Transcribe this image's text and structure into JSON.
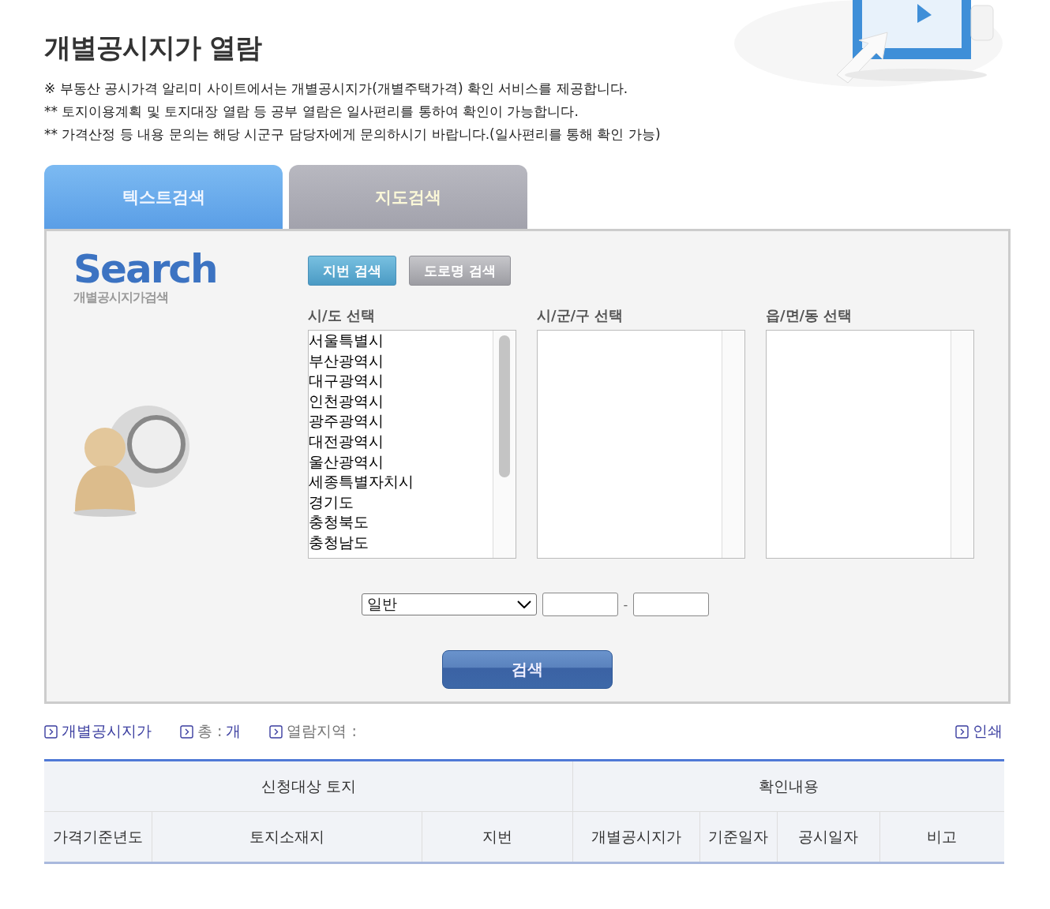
{
  "title": "개별공시지가 열람",
  "notices": [
    "※ 부동산 공시가격 알리미 사이트에서는 개별공시지가(개별주택가격) 확인 서비스를 제공합니다.",
    "** 토지이용계획 및 토지대장 열람 등 공부 열람은 일사편리를 통하여 확인이 가능합니다.",
    "** 가격산정 등 내용 문의는 해당 시군구 담당자에게 문의하시기 바랍니다.(일사편리를 통해 확인 가능)"
  ],
  "tabs": [
    {
      "label": "텍스트검색",
      "selected": true
    },
    {
      "label": "지도검색",
      "selected": false
    }
  ],
  "logo": {
    "word": "Search",
    "subtitle": "개별공시지가검색"
  },
  "search_modes": [
    {
      "label": "지번 검색",
      "selected": true
    },
    {
      "label": "도로명 검색",
      "selected": false
    }
  ],
  "lists": [
    {
      "label": "시/도 선택",
      "items": [
        "서울특별시",
        "부산광역시",
        "대구광역시",
        "인천광역시",
        "광주광역시",
        "대전광역시",
        "울산광역시",
        "세종특별자치시",
        "경기도",
        "충청북도",
        "충청남도"
      ]
    },
    {
      "label": "시/군/구 선택"
    },
    {
      "label": "읍/면/동 선택"
    }
  ],
  "lot_type": {
    "value": "일반"
  },
  "separator": "-",
  "search_button": "검색",
  "summary": [
    {
      "kind": "title",
      "label": "개별공시지가"
    },
    {
      "kind": "field",
      "label": "총 :",
      "value": "개"
    },
    {
      "kind": "field",
      "label": "열람지역 :"
    }
  ],
  "print_link": "인쇄",
  "table": {
    "groups": [
      {
        "label": "신청대상 토지"
      },
      {
        "label": "확인내용"
      }
    ],
    "columns": [
      "가격기준년도",
      "토지소재지",
      "지번",
      "개별공시지가",
      "기준일자",
      "공시일자",
      "비고"
    ]
  }
}
